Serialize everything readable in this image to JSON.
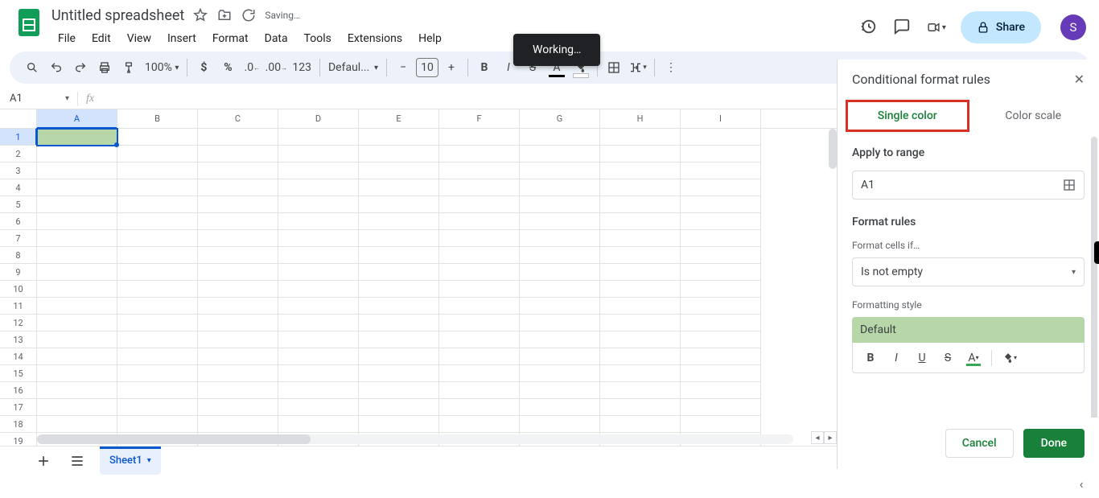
{
  "doc": {
    "name": "Untitled spreadsheet",
    "saving": "Saving…"
  },
  "menus": [
    "File",
    "Edit",
    "View",
    "Insert",
    "Format",
    "Data",
    "Tools",
    "Extensions",
    "Help"
  ],
  "toolbar": {
    "zoom": "100%",
    "font": "Defaul...",
    "font_size": "10",
    "num_fmt": "123"
  },
  "share": "Share",
  "avatar": "S",
  "namebox": "A1",
  "columns": [
    "A",
    "B",
    "C",
    "D",
    "E",
    "F",
    "G",
    "H",
    "I"
  ],
  "rows": [
    "1",
    "2",
    "3",
    "4",
    "5",
    "6",
    "7",
    "8",
    "9",
    "10",
    "11",
    "12",
    "13",
    "14",
    "15",
    "16",
    "17",
    "18",
    "19"
  ],
  "toast": "Working…",
  "sheettab": "Sheet1",
  "sidebar": {
    "title": "Conditional format rules",
    "tabs": {
      "single": "Single color",
      "scale": "Color scale"
    },
    "apply_label": "Apply to range",
    "range": "A1",
    "rules_label": "Format rules",
    "cells_if_label": "Format cells if…",
    "condition": "Is not empty",
    "style_label": "Formatting style",
    "style_preview": "Default",
    "cancel": "Cancel",
    "done": "Done"
  }
}
